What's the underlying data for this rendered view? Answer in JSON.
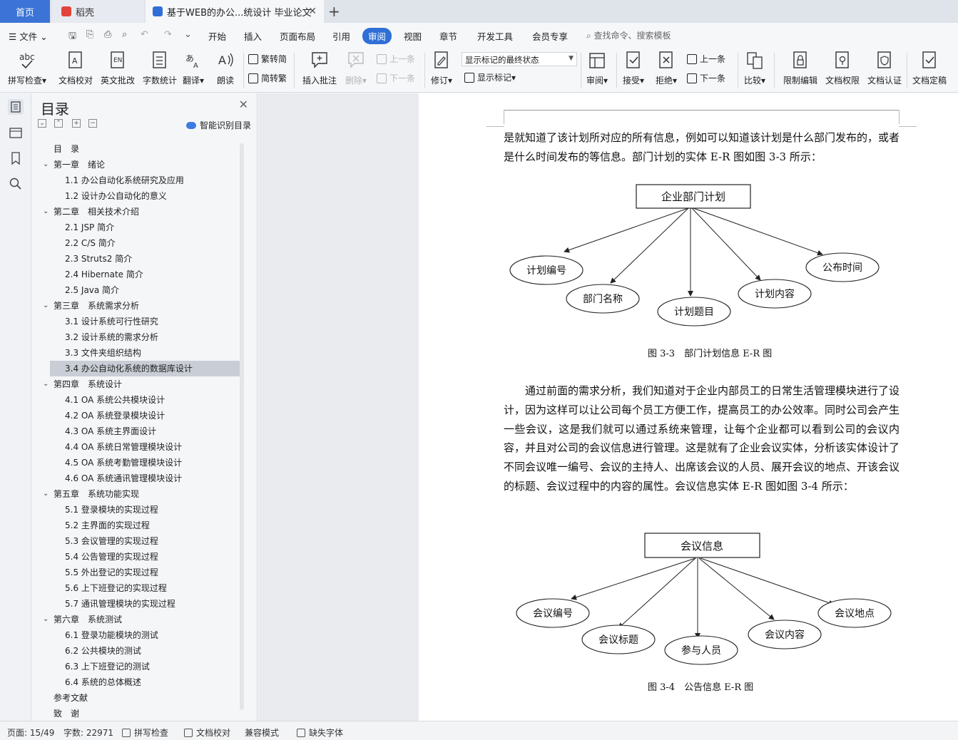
{
  "tabs": {
    "home": "首页",
    "daoke": "稻壳",
    "doc": "基于WEB的办公...统设计 毕业论文",
    "colors": {
      "active_home": "#3b74d6",
      "daoke_icon": "#e2443a",
      "doc_icon": "#2f6fd6"
    }
  },
  "menu": {
    "file": "文件",
    "items": [
      "开始",
      "插入",
      "页面布局",
      "引用",
      "审阅",
      "视图",
      "章节",
      "开发工具",
      "会员专享"
    ],
    "active": "审阅",
    "search": "查找命令、搜索模板"
  },
  "ribbon": {
    "spellcheck": "拼写检查",
    "doc_proof": "文档校对",
    "eng_review": "英文批改",
    "wordcount": "字数统计",
    "translate": "翻译",
    "read_aloud": "朗读",
    "trad": "繁转简",
    "simp": "简转繁",
    "insert_comment": "插入批注",
    "delete": "删除",
    "prev_comment": "上一条",
    "next_comment": "下一条",
    "track": "修订",
    "markup_state": "显示标记的最终状态",
    "show_markup": "显示标记",
    "review": "审阅",
    "accept": "接受",
    "reject": "拒绝",
    "prev_change": "上一条",
    "next_change": "下一条",
    "compare": "比较",
    "restrict": "限制编辑",
    "permission": "文档权限",
    "certify": "文档认证",
    "finalize": "文档定稿",
    "abc": "abc"
  },
  "toc": {
    "title": "目录",
    "smart": "智能识别目录",
    "items": [
      {
        "text": "目　录",
        "level": 0
      },
      {
        "text": "第一章　绪论",
        "level": 1
      },
      {
        "text": "1.1  办公自动化系统研究及应用",
        "level": 2
      },
      {
        "text": "1.2  设计办公自动化的意义",
        "level": 2
      },
      {
        "text": "第二章　相关技术介绍",
        "level": 1
      },
      {
        "text": "2.1 JSP 简介",
        "level": 2
      },
      {
        "text": "2.2 C/S 简介",
        "level": 2
      },
      {
        "text": "2.3 Struts2 简介",
        "level": 2
      },
      {
        "text": "2.4 Hibernate 简介",
        "level": 2
      },
      {
        "text": "2.5 Java 简介",
        "level": 2
      },
      {
        "text": "第三章　系统需求分析",
        "level": 1
      },
      {
        "text": "3.1  设计系统可行性研究",
        "level": 2
      },
      {
        "text": "3.2  设计系统的需求分析",
        "level": 2
      },
      {
        "text": "3.3  文件夹组织结构",
        "level": 2
      },
      {
        "text": "3.4  办公自动化系统的数据库设计",
        "level": 2,
        "selected": true
      },
      {
        "text": "第四章　系统设计",
        "level": 1
      },
      {
        "text": "4.1 OA 系统公共模块设计",
        "level": 2
      },
      {
        "text": "4.2 OA 系统登录模块设计",
        "level": 2
      },
      {
        "text": "4.3 OA 系统主界面设计",
        "level": 2
      },
      {
        "text": "4.4 OA 系统日常管理模块设计",
        "level": 2
      },
      {
        "text": "4.5 OA 系统考勤管理模块设计",
        "level": 2
      },
      {
        "text": "4.6 OA 系统通讯管理模块设计",
        "level": 2
      },
      {
        "text": "第五章　系统功能实现",
        "level": 1
      },
      {
        "text": "5.1  登录模块的实现过程",
        "level": 2
      },
      {
        "text": "5.2  主界面的实现过程",
        "level": 2
      },
      {
        "text": "5.3  会议管理的实现过程",
        "level": 2
      },
      {
        "text": "5.4  公告管理的实现过程",
        "level": 2
      },
      {
        "text": "5.5  外出登记的实现过程",
        "level": 2
      },
      {
        "text": "5.6  上下班登记的实现过程",
        "level": 2
      },
      {
        "text": "5.7  通讯管理模块的实现过程",
        "level": 2
      },
      {
        "text": "第六章　系统测试",
        "level": 1
      },
      {
        "text": "6.1  登录功能模块的测试",
        "level": 2
      },
      {
        "text": "6.2  公共模块的测试",
        "level": 2
      },
      {
        "text": "6.3  上下班登记的测试",
        "level": 2
      },
      {
        "text": "6.4  系统的总体概述",
        "level": 2
      },
      {
        "text": "参考文献",
        "level": 0
      },
      {
        "text": "致　谢",
        "level": 0
      }
    ]
  },
  "document": {
    "para1": "是就知道了该计划所对应的所有信息，例如可以知道该计划是什么部门发布的，或者是什么时间发布的等信息。部门计划的实体 E-R 图如图 3-3 所示：",
    "fig1": {
      "entity": "企业部门计划",
      "attrs": [
        "计划编号",
        "部门名称",
        "计划题目",
        "计划内容",
        "公布时间"
      ],
      "caption": "图 3-3　部门计划信息 E-R 图"
    },
    "para2": "通过前面的需求分析，我们知道对于企业内部员工的日常生活管理模块进行了设计，因为这样可以让公司每个员工方便工作，提高员工的办公效率。同时公司会产生一些会议，这是我们就可以通过系统来管理，让每个企业都可以看到公司的会议内容，并且对公司的会议信息进行管理。这是就有了企业会议实体，分析该实体设计了不同会议唯一编号、会议的主持人、出席该会议的人员、展开会议的地点、开该会议的标题、会议过程中的内容的属性。会议信息实体 E-R 图如图 3-4 所示：",
    "fig2": {
      "entity": "会议信息",
      "attrs": [
        "会议编号",
        "会议标题",
        "参与人员",
        "会议内容",
        "会议地点"
      ],
      "caption": "图 3-4　公告信息 E-R 图"
    }
  },
  "status": {
    "page": "页面: 15/49",
    "words": "字数: 22971",
    "spell": "拼写检查",
    "proof": "文档校对",
    "compat": "兼容模式",
    "missing_font": "缺失字体"
  }
}
